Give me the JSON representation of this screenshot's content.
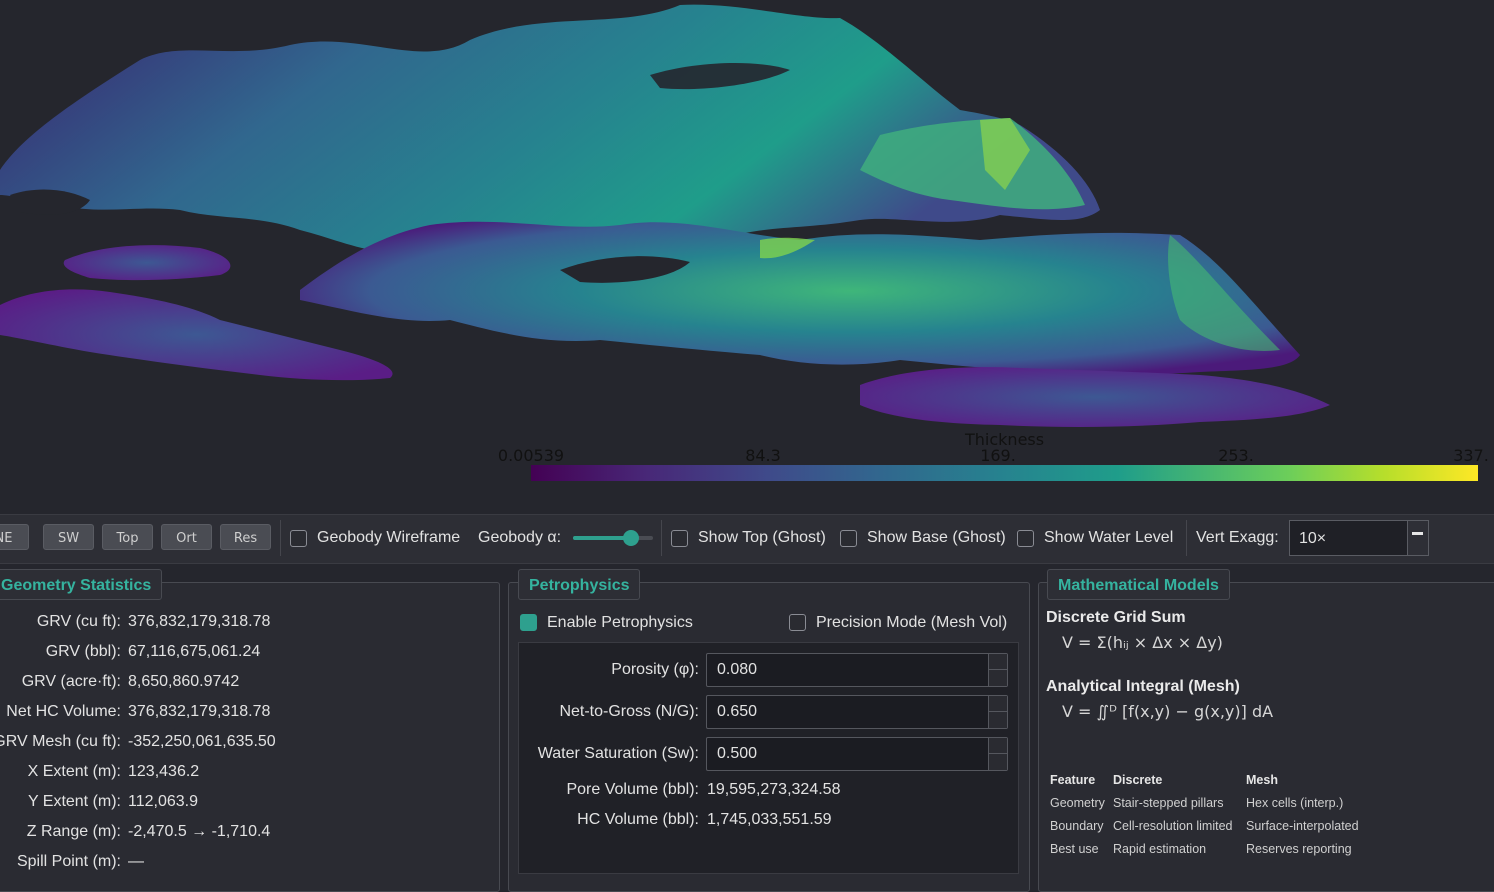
{
  "colorbar": {
    "title": "Thickness",
    "ticks": [
      "0.00539",
      "84.3",
      "169.",
      "253.",
      "337."
    ]
  },
  "toolbar": {
    "buttons": [
      "NE",
      "SW",
      "Top",
      "Ort",
      "Res"
    ],
    "geobody_wireframe": "Geobody Wireframe",
    "geobody_alpha": "Geobody α:",
    "geobody_alpha_value": 0.72,
    "show_top": "Show Top (Ghost)",
    "show_base": "Show Base (Ghost)",
    "show_water": "Show Water Level",
    "vert_exagg_label": "Vert Exagg:",
    "vert_exagg_value": "10×"
  },
  "geometry": {
    "title": "Geometry Statistics",
    "rows": [
      {
        "k": "GRV (cu ft):",
        "v": "376,832,179,318.78"
      },
      {
        "k": "GRV (bbl):",
        "v": "67,116,675,061.24"
      },
      {
        "k": "GRV (acre·ft):",
        "v": "8,650,860.9742"
      },
      {
        "k": "Net HC Volume:",
        "v": "376,832,179,318.78"
      },
      {
        "k": "GRV Mesh (cu ft):",
        "v": "-352,250,061,635.50"
      },
      {
        "k": "X Extent (m):",
        "v": "123,436.2"
      },
      {
        "k": "Y Extent (m):",
        "v": "112,063.9"
      },
      {
        "k": "Z Range (m):",
        "v": "-2,470.5 → -1,710.4"
      },
      {
        "k": "Spill Point (m):",
        "v": "—"
      }
    ]
  },
  "petro": {
    "title": "Petrophysics",
    "enable": "Enable Petrophysics",
    "precision": "Precision Mode (Mesh Vol)",
    "porosity_label": "Porosity (φ):",
    "porosity": "0.080",
    "ntg_label": "Net-to-Gross (N/G):",
    "ntg": "0.650",
    "sw_label": "Water Saturation (Sw):",
    "sw": "0.500",
    "pore_label": "Pore Volume (bbl):",
    "pore": "19,595,273,324.58",
    "hc_label": "HC Volume (bbl):",
    "hc": "1,745,033,551.59"
  },
  "math": {
    "title": "Mathematical Models",
    "discrete_head": "Discrete Grid Sum",
    "discrete_formula": "V = Σ(hᵢⱼ × Δx × Δy)",
    "analytic_head": "Analytical Integral (Mesh)",
    "analytic_formula": "V = ∬ᴰ [f(x,y) − g(x,y)] dA",
    "table": {
      "headers": [
        "Feature",
        "Discrete",
        "Mesh"
      ],
      "rows": [
        [
          "Geometry",
          "Stair-stepped pillars",
          "Hex cells (interp.)"
        ],
        [
          "Boundary",
          "Cell-resolution limited",
          "Surface-interpolated"
        ],
        [
          "Best use",
          "Rapid estimation",
          "Reserves reporting"
        ]
      ]
    }
  },
  "colors": {
    "accent": "#2ea08e",
    "title_accent": "#35b39f",
    "background": "#25262d"
  }
}
